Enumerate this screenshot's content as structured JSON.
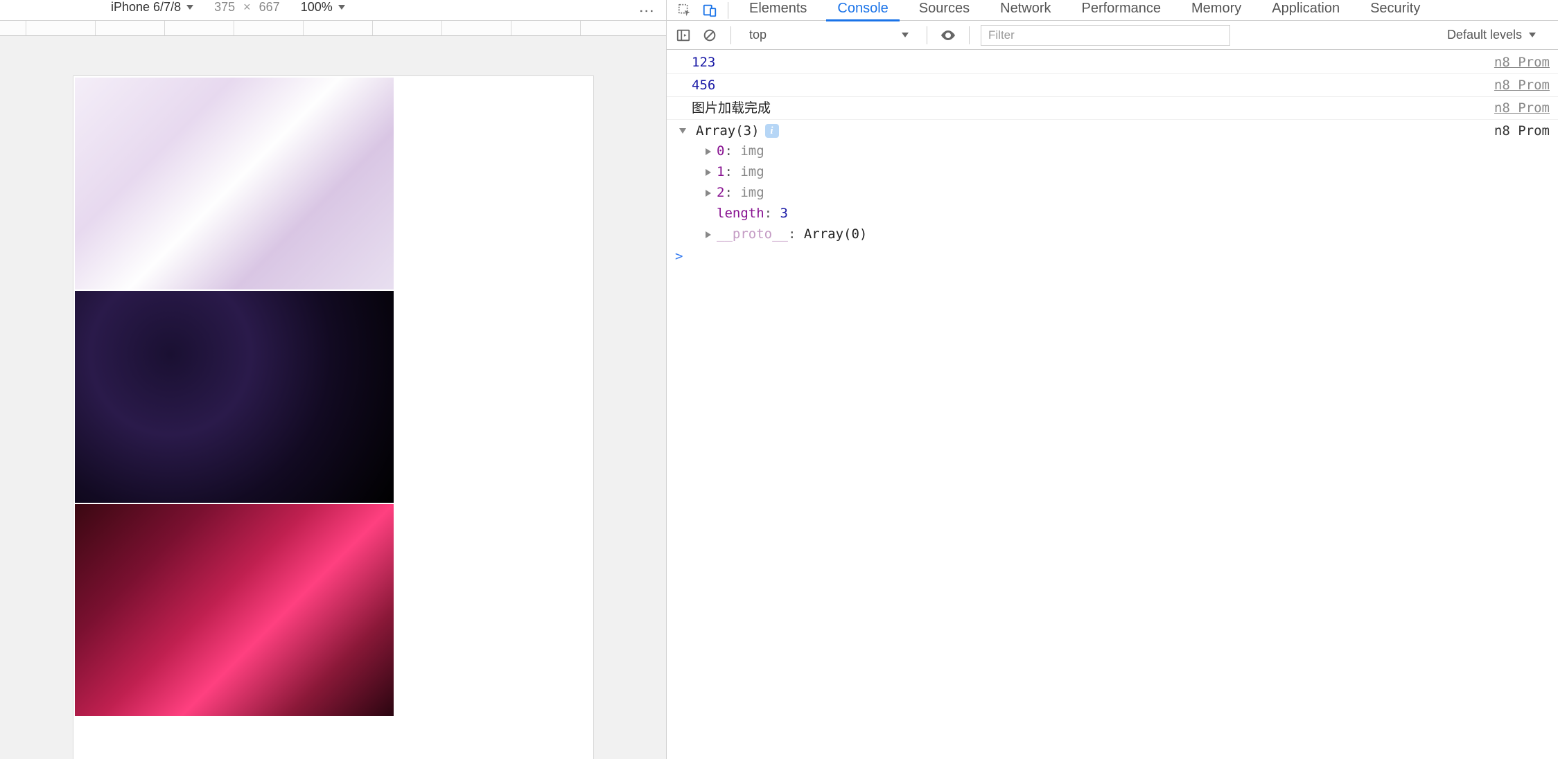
{
  "deviceToolbar": {
    "device": "iPhone 6/7/8",
    "width": "375",
    "height": "667",
    "dimSeparator": "×",
    "zoom": "100%"
  },
  "tabs": {
    "items": [
      {
        "label": "Elements"
      },
      {
        "label": "Console"
      },
      {
        "label": "Sources"
      },
      {
        "label": "Network"
      },
      {
        "label": "Performance"
      },
      {
        "label": "Memory"
      },
      {
        "label": "Application"
      },
      {
        "label": "Security"
      }
    ],
    "activeIndex": 1
  },
  "consoleToolbar": {
    "context": "top",
    "filterPlaceholder": "Filter",
    "levels": "Default levels"
  },
  "logs": {
    "line1": {
      "value": "123",
      "source": "n8 Prom"
    },
    "line2": {
      "value": "456",
      "source": "n8 Prom"
    },
    "line3": {
      "value": "图片加载完成",
      "source": "n8 Prom"
    },
    "array": {
      "summary": "Array(3)",
      "source": "n8 Prom",
      "items": [
        {
          "index": "0",
          "value": "img"
        },
        {
          "index": "1",
          "value": "img"
        },
        {
          "index": "2",
          "value": "img"
        }
      ],
      "lengthKey": "length",
      "lengthVal": "3",
      "protoKey": "__proto__",
      "protoVal": "Array(0)"
    }
  },
  "prompt": ">"
}
